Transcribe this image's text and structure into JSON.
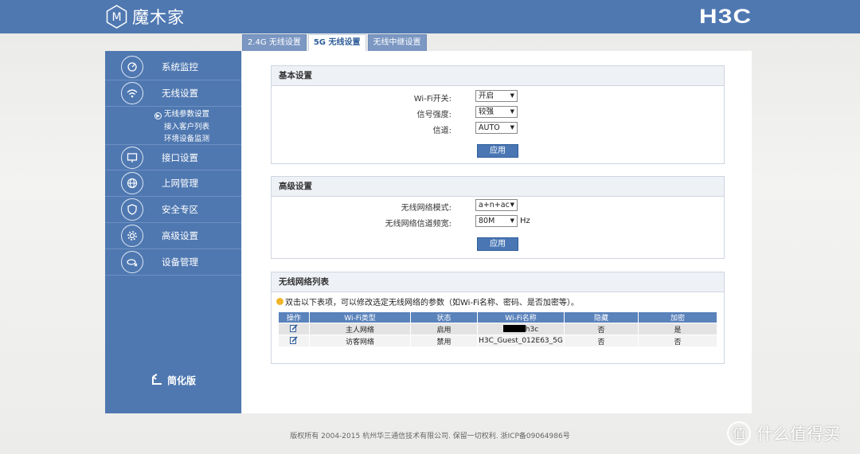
{
  "header": {
    "logo_letter": "M",
    "logo_text": "魔木家",
    "brand": "H3C"
  },
  "tabs": [
    {
      "label": "2.4G 无线设置",
      "active": false
    },
    {
      "label": "5G 无线设置",
      "active": true
    },
    {
      "label": "无线中继设置",
      "active": false
    }
  ],
  "sidebar": {
    "items": [
      {
        "label": "系统监控",
        "icon": "dashboard-icon"
      },
      {
        "label": "无线设置",
        "icon": "wifi-icon"
      },
      {
        "label": "接口设置",
        "icon": "monitor-icon"
      },
      {
        "label": "上网管理",
        "icon": "globe-icon"
      },
      {
        "label": "安全专区",
        "icon": "shield-icon"
      },
      {
        "label": "高级设置",
        "icon": "gear-icon"
      },
      {
        "label": "设备管理",
        "icon": "device-icon"
      }
    ],
    "subitems": [
      {
        "label": "无线参数设置",
        "active": true
      },
      {
        "label": "接入客户列表",
        "active": false
      },
      {
        "label": "环境设备监测",
        "active": false
      }
    ],
    "simple_mode": "简化版"
  },
  "basic": {
    "title": "基本设置",
    "wifi_switch_label": "Wi-Fi开关:",
    "wifi_switch_value": "开启",
    "signal_label": "信号强度:",
    "signal_value": "较强",
    "channel_label": "信道:",
    "channel_value": "AUTO",
    "apply": "应用"
  },
  "advanced": {
    "title": "高级设置",
    "mode_label": "无线网络模式:",
    "mode_value": "a+n+ac",
    "bandwidth_label": "无线网络信道频宽:",
    "bandwidth_value": "80M",
    "bandwidth_unit": "Hz",
    "apply": "应用"
  },
  "wifi_list": {
    "title": "无线网络列表",
    "hint": "双击以下表项，可以修改选定无线网络的参数（如Wi-Fi名称、密码、是否加密等）。",
    "columns": [
      "操作",
      "Wi-Fi类型",
      "状态",
      "Wi-Fi名称",
      "隐藏",
      "加密"
    ],
    "rows": [
      {
        "type": "主人网络",
        "status": "启用",
        "name": "h3c",
        "hidden": "否",
        "encrypted": "是"
      },
      {
        "type": "访客网络",
        "status": "禁用",
        "name": "H3C_Guest_012E63_5G",
        "hidden": "否",
        "encrypted": "否"
      }
    ]
  },
  "footer": "版权所有  2004-2015  杭州华三通信技术有限公司. 保留一切权利. 浙ICP备09064986号",
  "watermark": "什么值得买",
  "colors": {
    "primary": "#4f78b1",
    "accent": "#f0b429"
  }
}
